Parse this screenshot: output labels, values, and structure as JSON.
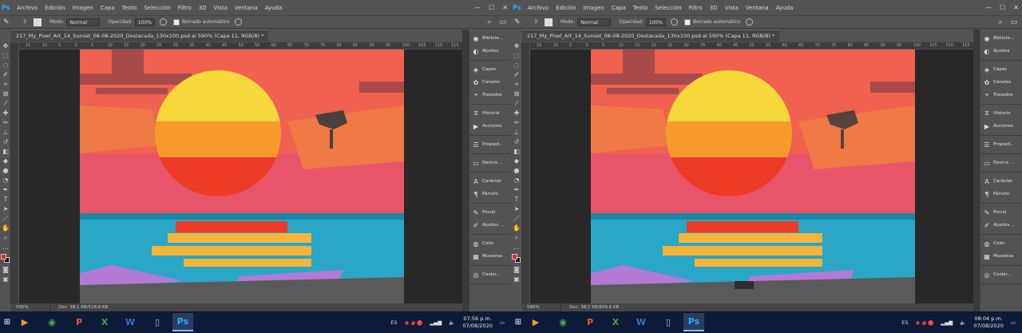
{
  "menu": {
    "app_icon": "Ps",
    "items": [
      "Archivo",
      "Edición",
      "Imagen",
      "Capa",
      "Texto",
      "Selección",
      "Filtro",
      "3D",
      "Vista",
      "Ventana",
      "Ayuda"
    ]
  },
  "options": {
    "brush_size": "3",
    "mode_label": "Modo:",
    "mode_value": "Normal",
    "opacity_label": "Opacidad:",
    "opacity_value": "100%",
    "auto_erase_label": "Borrado automático"
  },
  "left": {
    "doc_tab": "217_My_Pixel_Art_14_Sunset_08-08-2020_Destacada_130x100.psd al 590% (Capa 11, RGB/8) *",
    "zoom": "590%",
    "doc_size": "Doc: 38,1 KB/518,8 KB",
    "clock_time": "07:56 p.m.",
    "clock_date": "07/08/2020"
  },
  "right": {
    "doc_tab": "217_My_Pixel_Art_14_Sunset_08-08-2020_Destacada_130x100.psd al 590% (Capa 11, RGB/8) *",
    "zoom": "590%",
    "doc_size": "Doc: 38,1 KB/609,6 KB",
    "clock_time": "08:04 p.m.",
    "clock_date": "07/08/2020"
  },
  "ruler_ticks": [
    "15",
    "10",
    "5",
    "0",
    "5",
    "10",
    "15",
    "20",
    "25",
    "30",
    "35",
    "40",
    "45",
    "50",
    "55",
    "60",
    "65",
    "70",
    "75",
    "80",
    "85",
    "90",
    "95",
    "100",
    "105",
    "110",
    "115"
  ],
  "panels": [
    {
      "group": [
        {
          "icon": "library-icon",
          "glyph": "◉",
          "label": "Bibliote..."
        },
        {
          "icon": "adjustments-icon",
          "glyph": "◐",
          "label": "Ajustes"
        }
      ]
    },
    {
      "group": [
        {
          "icon": "layers-icon",
          "glyph": "◈",
          "label": "Capas"
        },
        {
          "icon": "channels-icon",
          "glyph": "✿",
          "label": "Canales"
        },
        {
          "icon": "paths-icon",
          "glyph": "⌖",
          "label": "Trazados"
        }
      ]
    },
    {
      "group": [
        {
          "icon": "history-icon",
          "glyph": "⧖",
          "label": "Historia"
        },
        {
          "icon": "actions-icon",
          "glyph": "▶",
          "label": "Acciones"
        }
      ]
    },
    {
      "group": [
        {
          "icon": "properties-icon",
          "glyph": "☰",
          "label": "Propied..."
        }
      ]
    },
    {
      "group": [
        {
          "icon": "device-preview-icon",
          "glyph": "▭",
          "label": "Device ..."
        }
      ]
    },
    {
      "group": [
        {
          "icon": "character-icon",
          "glyph": "A",
          "label": "Carácter"
        },
        {
          "icon": "paragraph-icon",
          "glyph": "¶",
          "label": "Párrafo"
        }
      ]
    },
    {
      "group": [
        {
          "icon": "brush-icon",
          "glyph": "✎",
          "label": "Pincel"
        },
        {
          "icon": "brush-settings-icon",
          "glyph": "✐",
          "label": "Ajustes ..."
        }
      ]
    },
    {
      "group": [
        {
          "icon": "color-icon",
          "glyph": "◍",
          "label": "Color"
        },
        {
          "icon": "swatches-icon",
          "glyph": "▦",
          "label": "Muestras"
        }
      ]
    },
    {
      "group": [
        {
          "icon": "cooler-icon",
          "glyph": "◎",
          "label": "Cooler..."
        }
      ]
    }
  ],
  "tray": {
    "lang": "ES"
  },
  "colors": {
    "sky_top": "#f0614f",
    "sky_pink": "#e8556a",
    "sky_orange": "#f07a45",
    "sun_yellow": "#f7d83a",
    "sun_orange": "#f79a2c",
    "sun_red": "#ee3b25",
    "sea": "#2aa6c6",
    "sea_dark": "#1888a6",
    "reflection": "#f5b43a",
    "purple": "#b27ad4",
    "sand": "#5a5a5a",
    "cloud_dark": "#a84a4a"
  }
}
